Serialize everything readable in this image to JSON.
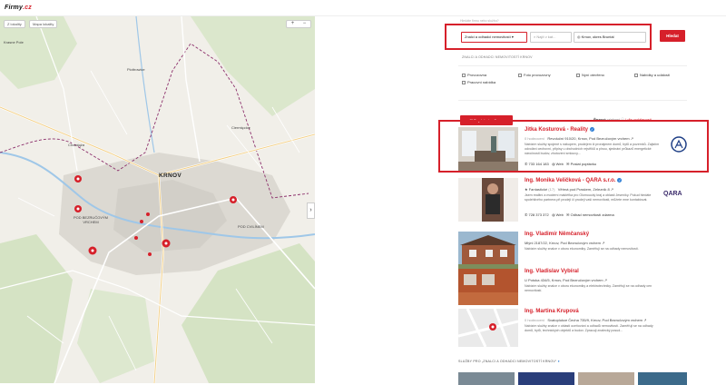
{
  "header": {
    "logo_main": "Firmy",
    "logo_dot": ".cz",
    "right_text": "—"
  },
  "map": {
    "btn_route": "Z lokality",
    "btn_layer": "Mapa lokality",
    "zoom_in": "+",
    "zoom_out": "−",
    "collapse_icon": "›",
    "labels": {
      "krasne_pole": "Krasne Pole",
      "piottrowice": "Piottrowice",
      "chomiaza": "Chomiąża",
      "ciermiecice": "Ciermięcice",
      "krnov": "KRNOV",
      "pod_bezrucovym": "POD BEZRUČOVÝM VRCHEM",
      "pod_cvilinem": "POD CVILÍNEM"
    },
    "colors": {
      "bg": "#f1efe9",
      "water": "#9fc7e8",
      "city": "#d8d6d0",
      "forest": "#d2e3c1",
      "pin": "#d6202a"
    }
  },
  "search": {
    "caption": "Hledáte firmu nebo službu?",
    "category": "Znalci a odhadci nemovitostí",
    "query_placeholder": "Najít v kat...",
    "location": "Krnov, okres Bruntál",
    "button": "Hledat"
  },
  "section_caption": "ZNALCI A ODHADCI NEMOVITOSTÍ KRNOV",
  "filters": [
    "Provozovna",
    "Foto provozovny",
    "Nyní otevřeno",
    "Nabídky a události",
    "Pracovní nabídka"
  ],
  "multi_button": "Poptat více firem",
  "sort": {
    "label": "Řazení:",
    "active": "výchozí",
    "info": "ⓘ",
    "link": "dle vzdálenosti"
  },
  "listings": [
    {
      "title": "Jitka Kosturová - Reality",
      "reviews": "0 hodnocení",
      "address": "Revoluční 910/20, Krnov, Pod Bezručovým vrchem",
      "desc": "Nabízím služby spojené s nákupem, prodejem či pronájmem domů, bytů a pozemků. Zajistím odvolání cechovní, přípisy u obchodních rejstříků a plnou, sjednání průkazů energetické náročnosti budov, zhotovení smlouvy...",
      "phone": "733 164 183",
      "web": "Web",
      "cta": "Poslat poptávku"
    },
    {
      "title": "Ing. Monika Veličková - QARA s.r.o.",
      "reviews": "Fantastické",
      "rating_count": "(17)",
      "address": "Větrná pod Praskem, Zeleznik 8",
      "desc": "Jsem realitní a moderní makléřka pro Olomoucký kraj a oblasti Jeseníky. Pokud hledáte spolehlivého partnera při prodeji či prodeji vaší nemovitosti, můžete mne kontaktovat.",
      "phone": "728 373 372",
      "web": "Web",
      "cta": "Odhad nemovitostí zdarma",
      "logo": "QARA"
    },
    {
      "title": "Ing. Vladimír Němčanský",
      "reviews": "",
      "address": "Mlýnl 2187/22, Krnov, Pod Bezručovým vrchem",
      "desc": "Nabízím služby znalce v oboru ekonomiky. Zaměřuji se na odhady nemovitostí."
    },
    {
      "title": "Ing. Vladislav Vybíral",
      "reviews": "",
      "address": "U Potoka 434/5, Krnov, Pod Bezručovým vrchem",
      "desc": "Nabízím služby znalce v oboru ekonomiky a elektrotechniky. Zaměřuji se na odhady cen nemovitostí."
    },
    {
      "title": "Ing. Martina Krupová",
      "reviews": "0 hodnocení",
      "address": "Svatoplukce Čecha 735/9, Krnov, Pod Bezručovým vrchem",
      "desc": "Nabízím služby znalce v oblasti oceňování a odhadů nemovitostí. Zaměřuji se na odhady domů, bytů, technických objektů a budov. Zpracuji znalecký posud..."
    }
  ],
  "related_caption": "SLUŽBY PRO „ZNALCI A ODHADCI NEMOVITOSTÍ KRNOV“"
}
